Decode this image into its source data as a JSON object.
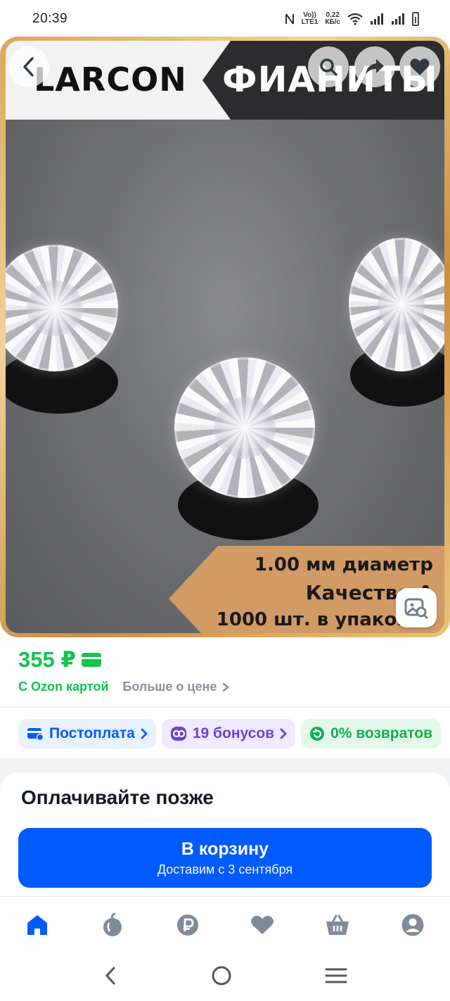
{
  "status_bar": {
    "time": "20:39",
    "network_speed_value": "0,22",
    "network_speed_unit": "КБ/с",
    "volte_line1": "Vo))",
    "volte_line2": "LTE1"
  },
  "hero": {
    "brand": "LARCON",
    "banner_title": "ФИАНИТЫ",
    "spec_diameter": "1.00 мм диаметр",
    "spec_quality": "Качество А",
    "spec_quantity": "1000 шт. в упаковке"
  },
  "price": {
    "value": "355 ₽",
    "card_label": "С Ozon картой",
    "more_label": "Больше о цене"
  },
  "chips": [
    {
      "label": "Постоплата"
    },
    {
      "label": "19 бонусов"
    },
    {
      "label": "0% возвратов"
    }
  ],
  "pay_later_title": "Оплачивайте позже",
  "cart_button": {
    "title": "В корзину",
    "subtitle": "Доставим с 3 сентября"
  },
  "colors": {
    "accent_blue": "#005bff",
    "price_green": "#10c44c"
  },
  "tabs": [
    {
      "icon": "home-icon",
      "active": true
    },
    {
      "icon": "fresh-icon"
    },
    {
      "icon": "ruble-icon"
    },
    {
      "icon": "heart-icon"
    },
    {
      "icon": "cart-basket-icon"
    },
    {
      "icon": "profile-icon"
    }
  ]
}
